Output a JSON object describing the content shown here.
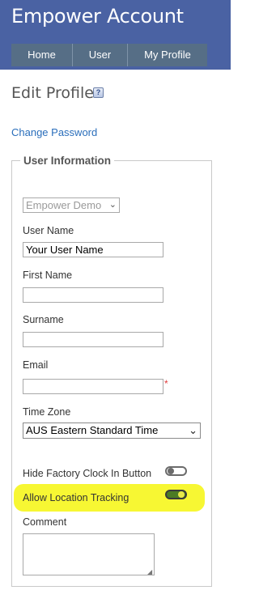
{
  "header": {
    "app_title": "Empower Account",
    "nav": [
      {
        "label": "Home"
      },
      {
        "label": "User"
      },
      {
        "label": "My Profile"
      }
    ]
  },
  "page": {
    "title": "Edit Profile",
    "help_icon": "help-icon",
    "change_password_link": "Change Password"
  },
  "user_info": {
    "legend": "User Information",
    "company_select": {
      "selected": "Empower Demo",
      "disabled": true
    },
    "user_name": {
      "label": "User Name",
      "value": "Your User Name"
    },
    "first_name": {
      "label": "First Name",
      "value": ""
    },
    "surname": {
      "label": "Surname",
      "value": ""
    },
    "email": {
      "label": "Email",
      "value": "",
      "required_marker": "*"
    },
    "time_zone": {
      "label": "Time Zone",
      "selected": "AUS Eastern Standard Time"
    },
    "hide_factory_clock": {
      "label": "Hide Factory Clock In Button",
      "state": "off"
    },
    "allow_location_tracking": {
      "label": "Allow Location Tracking",
      "state": "on",
      "highlighted": true
    },
    "comment": {
      "label": "Comment",
      "value": ""
    }
  },
  "colors": {
    "header_bg": "#4a62a3",
    "nav_bg": "#566e86",
    "link": "#2a6ebb",
    "highlight": "#f7f733",
    "toggle_on": "#4b7b24",
    "required": "#e03c3c"
  }
}
